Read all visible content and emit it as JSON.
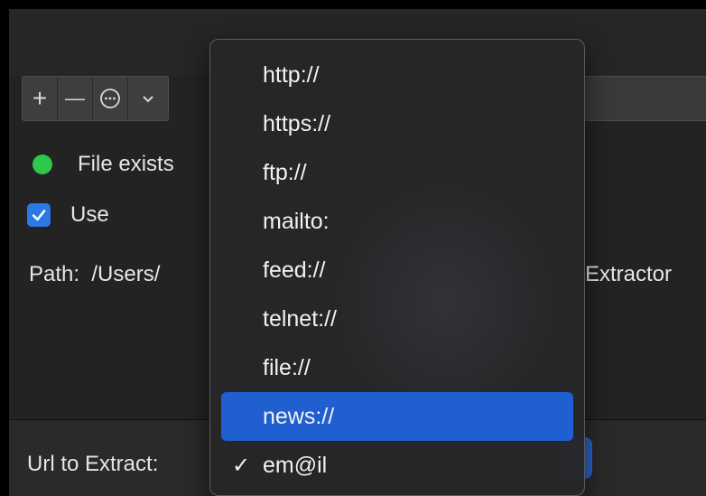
{
  "toolbar": {
    "buttons": [
      {
        "name": "add",
        "glyph": "+"
      },
      {
        "name": "remove",
        "glyph": "—"
      },
      {
        "name": "more",
        "glyph": "⊙"
      },
      {
        "name": "chevron",
        "glyph": "⌄"
      }
    ]
  },
  "status": {
    "indicator_color": "#2ec84a",
    "text": "File exists"
  },
  "use_checkbox": {
    "checked": true,
    "label": "Use"
  },
  "path": {
    "label": "Path:",
    "value_start": "/Users/",
    "value_end": "Extractor"
  },
  "url_extract": {
    "label": "Url to Extract:"
  },
  "menu": {
    "items": [
      {
        "label": "http://",
        "checked": false,
        "highlighted": false
      },
      {
        "label": "https://",
        "checked": false,
        "highlighted": false
      },
      {
        "label": "ftp://",
        "checked": false,
        "highlighted": false
      },
      {
        "label": "mailto:",
        "checked": false,
        "highlighted": false
      },
      {
        "label": "feed://",
        "checked": false,
        "highlighted": false
      },
      {
        "label": "telnet://",
        "checked": false,
        "highlighted": false
      },
      {
        "label": "file://",
        "checked": false,
        "highlighted": false
      },
      {
        "label": "news://",
        "checked": false,
        "highlighted": true
      },
      {
        "label": "em@il",
        "checked": true,
        "highlighted": false
      }
    ],
    "check_glyph": "✓"
  },
  "colors": {
    "accent": "#1f5fd0",
    "checkbox": "#2c79e6",
    "status_green": "#2ec84a"
  }
}
